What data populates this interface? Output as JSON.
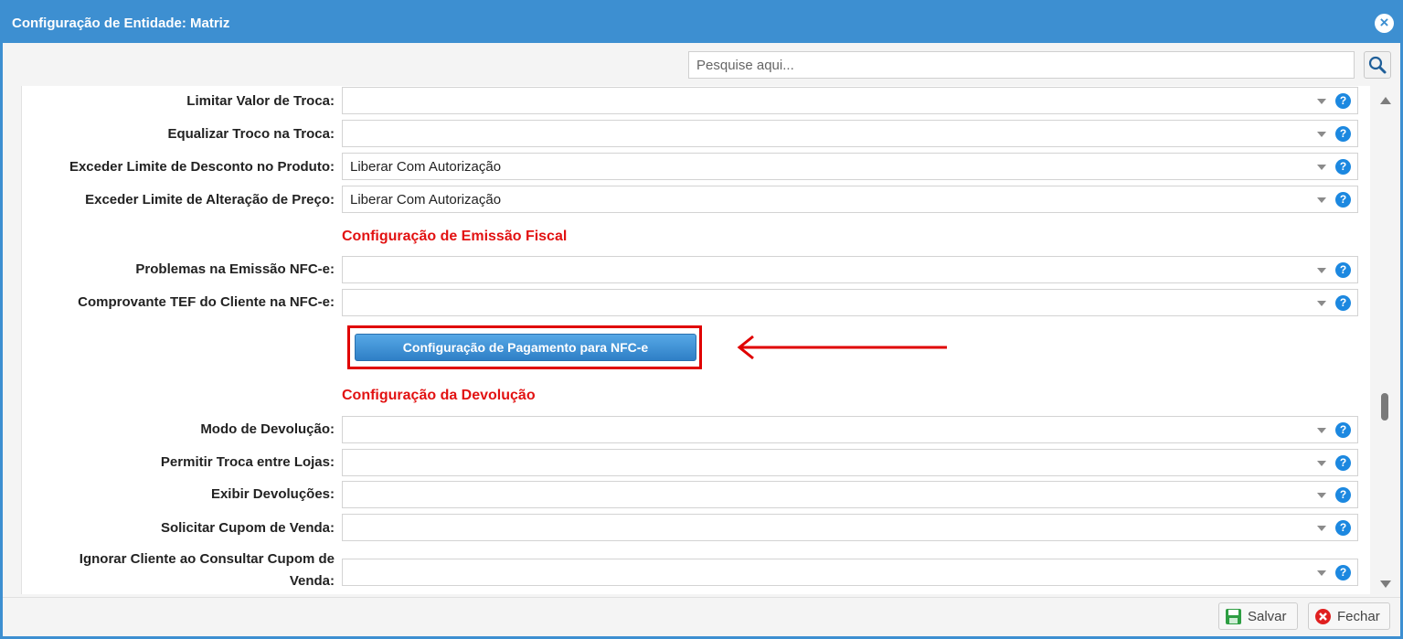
{
  "window": {
    "title": "Configuração de Entidade: Matriz"
  },
  "search": {
    "placeholder": "Pesquise aqui..."
  },
  "fields_top": [
    {
      "label": "Limitar Valor de Troca:",
      "value": ""
    },
    {
      "label": "Equalizar Troco na Troca:",
      "value": ""
    },
    {
      "label": "Exceder Limite de Desconto no Produto:",
      "value": "Liberar Com Autorização"
    },
    {
      "label": "Exceder Limite de Alteração de Preço:",
      "value": "Liberar Com Autorização"
    }
  ],
  "section_fiscal": {
    "title": "Configuração de Emissão Fiscal"
  },
  "fields_fiscal": [
    {
      "label": "Problemas na Emissão NFC-e:",
      "value": ""
    },
    {
      "label": "Comprovante TEF do Cliente na NFC-e:",
      "value": ""
    }
  ],
  "payment_button": {
    "label": "Configuração de Pagamento para NFC-e"
  },
  "section_devolucao": {
    "title": "Configuração da Devolução"
  },
  "fields_devolucao": [
    {
      "label": "Modo de Devolução:",
      "value": ""
    },
    {
      "label": "Permitir Troca entre Lojas:",
      "value": ""
    },
    {
      "label": "Exibir Devoluções:",
      "value": ""
    },
    {
      "label": "Solicitar Cupom de Venda:",
      "value": ""
    },
    {
      "label_line1": "Ignorar Cliente ao Consultar Cupom de",
      "label_line2": "Venda:",
      "value": ""
    }
  ],
  "help_symbol": "?",
  "footer": {
    "save_label": "Salvar",
    "close_label": "Fechar"
  },
  "colors": {
    "titlebar": "#3d8fd1",
    "section_title": "#e21212",
    "annotation": "#e00000",
    "help": "#1c88e0"
  }
}
